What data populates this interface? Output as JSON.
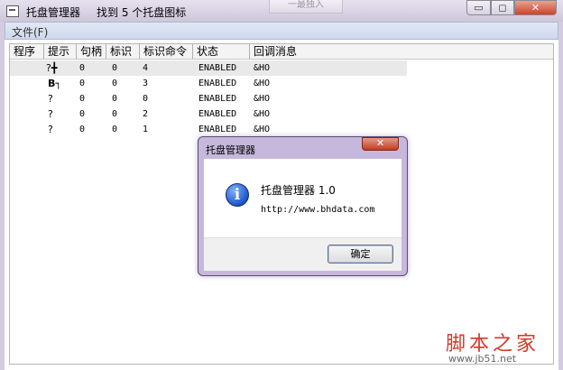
{
  "window": {
    "title": "托盘管理器",
    "status": "找到 5 个托盘图标",
    "ghost_tab": "一最独入",
    "min_glyph": "▭",
    "max_glyph": "◻",
    "close_glyph": "✕"
  },
  "menu": {
    "file": "文件(F)"
  },
  "table": {
    "headers": [
      "程序",
      "提示",
      "句柄",
      "标识",
      "标识命令",
      "状态",
      "回调消息"
    ],
    "rows": [
      {
        "tip": "?╋",
        "handle": "0",
        "id": "0",
        "cmd": "4",
        "status": "ENABLED",
        "callback": "&HO"
      },
      {
        "tip": "B┐",
        "handle": "0",
        "id": "0",
        "cmd": "3",
        "status": "ENABLED",
        "callback": "&HO"
      },
      {
        "tip": "?",
        "handle": "0",
        "id": "0",
        "cmd": "0",
        "status": "ENABLED",
        "callback": "&HO"
      },
      {
        "tip": "?",
        "handle": "0",
        "id": "0",
        "cmd": "2",
        "status": "ENABLED",
        "callback": "&HO"
      },
      {
        "tip": "?",
        "handle": "0",
        "id": "0",
        "cmd": "1",
        "status": "ENABLED",
        "callback": "&HO"
      }
    ]
  },
  "dialog": {
    "title": "托盘管理器",
    "close_glyph": "✕",
    "icon": "info-icon",
    "icon_glyph": "i",
    "line1": "托盘管理器 1.0",
    "line2": "http://www.bhdata.com",
    "ok": "确定"
  },
  "watermark": {
    "text": "脚本之家",
    "url": "www.jb51.net"
  },
  "colors": {
    "titlebar": "#d3cce0",
    "dialog_frame": "#c6b8dc",
    "close": "#c7462c",
    "watermark": "#d23a2a"
  }
}
